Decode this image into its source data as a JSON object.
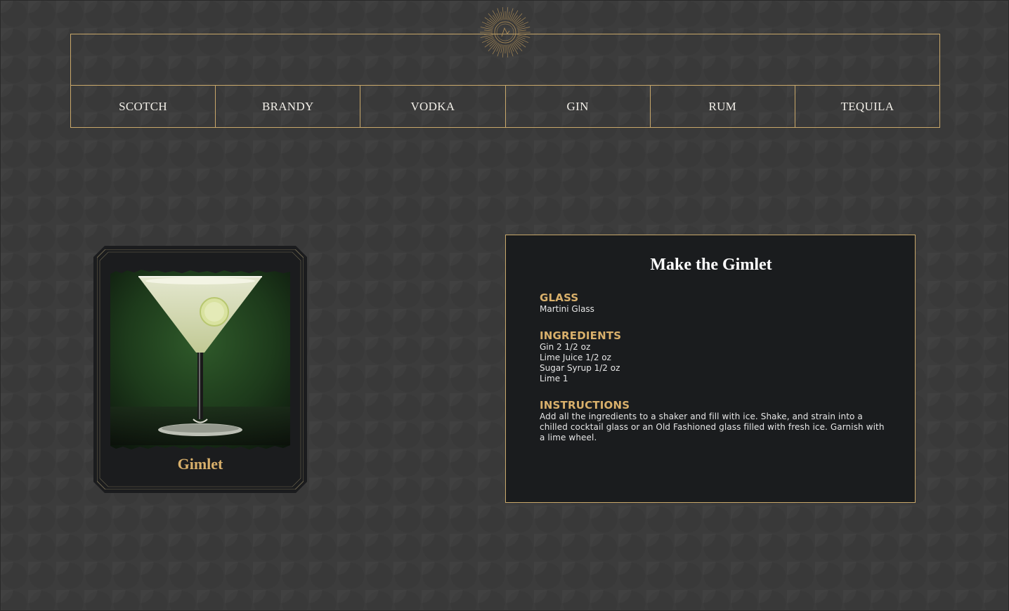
{
  "nav": {
    "items": [
      {
        "label": "SCOTCH"
      },
      {
        "label": "BRANDY"
      },
      {
        "label": "VODKA"
      },
      {
        "label": "GIN"
      },
      {
        "label": "RUM"
      },
      {
        "label": "TEQUILA"
      }
    ]
  },
  "card": {
    "name": "Gimlet",
    "image": "martini-glass-photo"
  },
  "recipe": {
    "title": "Make the Gimlet",
    "glass_heading": "GLASS",
    "glass": "Martini Glass",
    "ingredients_heading": "INGREDIENTS",
    "ingredients": [
      "Gin 2 1/2 oz",
      "Lime Juice 1/2 oz",
      "Sugar Syrup 1/2 oz",
      "Lime 1"
    ],
    "instructions_heading": "INSTRUCTIONS",
    "instructions": "Add all the ingredients to a shaker and fill with ice. Shake, and strain into a chilled cocktail glass or an Old Fashioned glass filled with fresh ice. Garnish with a lime wheel."
  },
  "colors": {
    "accent": "#d9b06b",
    "border": "#c9a86a",
    "background": "#3c3c3c",
    "panel": "#1a1c1e"
  },
  "icons": {
    "logo": "sunburst-logo-icon"
  }
}
